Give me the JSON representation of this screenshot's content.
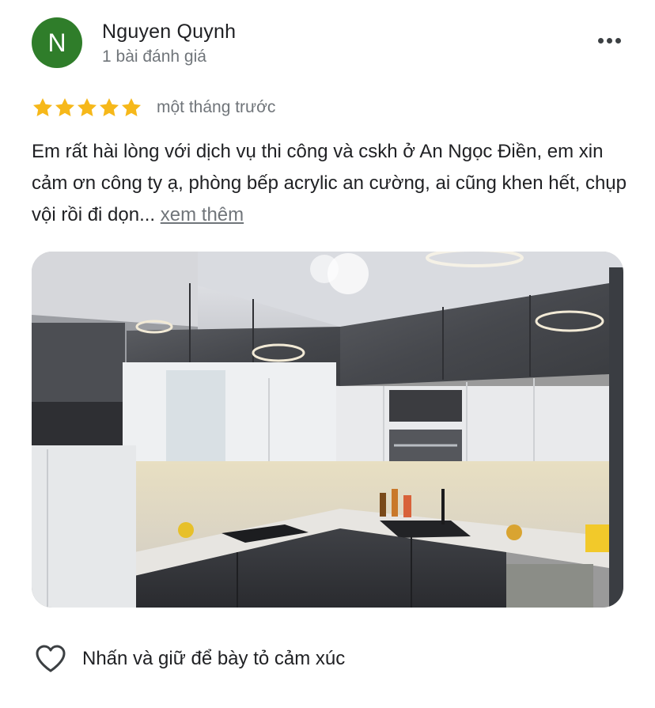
{
  "reviewer": {
    "avatar_letter": "N",
    "avatar_color": "#2f7d2a",
    "name": "Nguyen Quynh",
    "review_count": "1 bài đánh giá"
  },
  "rating": {
    "stars": 5,
    "max_stars": 5,
    "star_color": "#f6b81a",
    "time": "một tháng trước"
  },
  "review": {
    "text": "Em rất hài lòng với dịch vụ thi công và cskh ở An Ngọc Điền, em xin cảm ơn công ty ạ, phòng bếp acrylic an cường, ai cũng khen hết, chụp vội rồi đi dọn...",
    "more_label": "xem thêm"
  },
  "photo": {
    "icon": "kitchen-photo"
  },
  "reaction": {
    "icon": "heart-outline-icon",
    "label": "Nhấn và giữ để bày tỏ cảm xúc"
  },
  "menu": {
    "icon": "more-horizontal-icon"
  }
}
